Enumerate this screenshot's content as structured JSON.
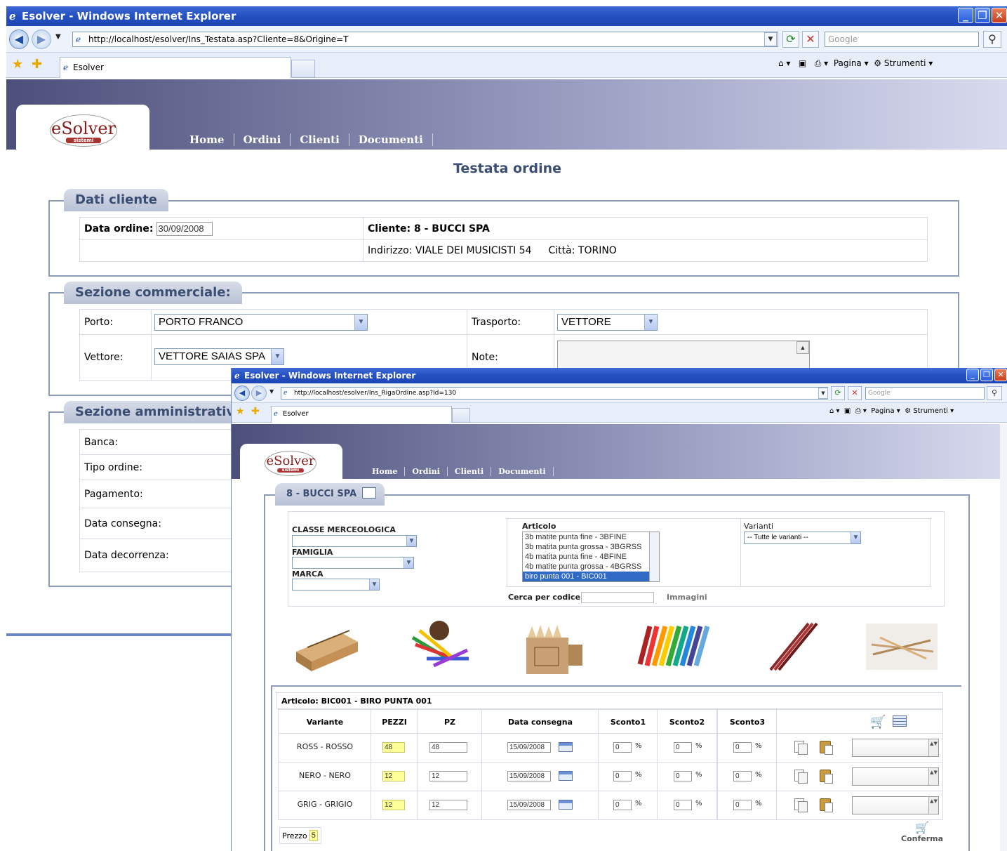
{
  "window1": {
    "title": "Esolver - Windows Internet Explorer",
    "url": "http://localhost/esolver/Ins_Testata.asp?Cliente=8&Origine=T",
    "search_placeholder": "Google",
    "tab_label": "Esolver",
    "cmd_pagina": "Pagina",
    "cmd_strumenti": "Strumenti",
    "logo_text": "eSolver",
    "logo_sub": "sistemi",
    "menu": [
      "Home",
      "Ordini",
      "Clienti",
      "Documenti"
    ],
    "page_title": "Testata ordine",
    "dati_cliente": {
      "legend": "Dati cliente",
      "data_ordine_label": "Data ordine:",
      "data_ordine_value": "30/09/2008",
      "cliente": "Cliente: 8 - BUCCI SPA",
      "indirizzo": "Indirizzo: VIALE DEI MUSICISTI 54",
      "citta": "Città: TORINO"
    },
    "commerciale": {
      "legend": "Sezione commerciale:",
      "porto_label": "Porto:",
      "porto_value": "PORTO FRANCO",
      "trasporto_label": "Trasporto:",
      "trasporto_value": "VETTORE",
      "vettore_label": "Vettore:",
      "vettore_value": "VETTORE SAIAS SPA",
      "note_label": "Note:"
    },
    "amministrativa": {
      "legend": "Sezione amministrativa",
      "fields": [
        "Banca:",
        "Tipo ordine:",
        "Pagamento:",
        "Data consegna:",
        "Data decorrenza:"
      ]
    }
  },
  "window2": {
    "title": "Esolver - Windows Internet Explorer",
    "url": "http://localhost/esolver/Ins_RigaOrdine.asp?Id=130",
    "search_placeholder": "Google",
    "tab_label": "Esolver",
    "cmd_pagina": "Pagina",
    "cmd_strumenti": "Strumenti",
    "logo_text": "eSolver",
    "logo_sub": "sistemi",
    "menu": [
      "Home",
      "Ordini",
      "Clienti",
      "Documenti"
    ],
    "customer_legend": "8 - BUCCI SPA",
    "filters": {
      "classe_label": "CLASSE MERCEOLOGICA",
      "famiglia_label": "FAMIGLIA",
      "marca_label": "MARCA",
      "articolo_label": "Articolo",
      "articoli": [
        "3b matite punta fine - 3BFINE",
        "3b matita punta grossa - 3BGRSS",
        "4b matita punta fine - 4BFINE",
        "4b matite punta grossa - 4BGRSS",
        "biro punta 001 - BIC001"
      ],
      "selected_index": 4,
      "varianti_label": "Varianti",
      "varianti_value": "-- Tutte le varianti --",
      "cerca_label": "Cerca per codice:",
      "immagini_label": "Immagini"
    },
    "articolo_header": "Articolo: BIC001 - BIRO PUNTA 001",
    "columns": [
      "Variante",
      "PEZZI",
      "PZ",
      "Data consegna",
      "Sconto1",
      "Sconto2",
      "Sconto3"
    ],
    "rows": [
      {
        "variante": "ROSS - ROSSO",
        "pezzi": "48",
        "pz": "48",
        "data": "15/09/2008",
        "s1": "0",
        "s2": "0",
        "s3": "0"
      },
      {
        "variante": "NERO - NERO",
        "pezzi": "12",
        "pz": "12",
        "data": "15/09/2008",
        "s1": "0",
        "s2": "0",
        "s3": "0"
      },
      {
        "variante": "GRIG - GRIGIO",
        "pezzi": "12",
        "pz": "12",
        "data": "15/09/2008",
        "s1": "0",
        "s2": "0",
        "s3": "0"
      }
    ],
    "percent": "%",
    "prezzo_label": "Prezzo",
    "prezzo_value": "5",
    "conferma_label": "Conferma"
  },
  "colors": {
    "titlebar": "#2450c0",
    "legend_text": "#3a4d73",
    "highlight": "#ffff99",
    "selected": "#316ac5"
  }
}
